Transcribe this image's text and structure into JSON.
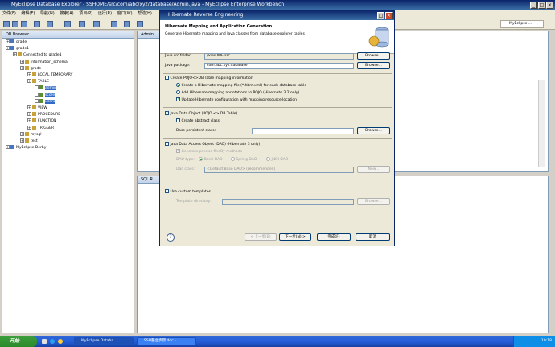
{
  "app": {
    "title": "MyEclipse Database Explorer - SSHOME/src/com/abc/xyz/database/Admin.java - MyEclipse Enterprise Workbench",
    "menu": [
      "文件(F)",
      "编辑(E)",
      "导航(N)",
      "搜索(A)",
      "项目(P)",
      "运行(R)",
      "窗口(W)",
      "帮助(H)"
    ],
    "perspective_label": "MyEclipse ...",
    "editor_tab": "Admin",
    "sql_tab": "SQL R"
  },
  "explorer": {
    "title": "DB Browser",
    "tree": [
      {
        "label": "grade",
        "level": 0,
        "icon": "db"
      },
      {
        "label": "grade1",
        "level": 0,
        "icon": "db"
      },
      {
        "label": "Connected to grade1",
        "level": 1,
        "icon": "folder"
      },
      {
        "label": "information_schema",
        "level": 2,
        "icon": "folder"
      },
      {
        "label": "grade",
        "level": 2,
        "icon": "folder"
      },
      {
        "label": "LOCAL TEMPORARY",
        "level": 3,
        "icon": "folder"
      },
      {
        "label": "TABLE",
        "level": 3,
        "icon": "folder"
      },
      {
        "label": "admin",
        "level": 4,
        "icon": "table",
        "selected": true
      },
      {
        "label": "score",
        "level": 4,
        "icon": "table",
        "selected": true
      },
      {
        "label": "users",
        "level": 4,
        "icon": "table",
        "selected": true
      },
      {
        "label": "VIEW",
        "level": 3,
        "icon": "folder"
      },
      {
        "label": "PROCEDURE",
        "level": 3,
        "icon": "folder"
      },
      {
        "label": "FUNCTION",
        "level": 3,
        "icon": "folder"
      },
      {
        "label": "TRIGGER",
        "level": 3,
        "icon": "folder"
      },
      {
        "label": "mysql",
        "level": 2,
        "icon": "folder"
      },
      {
        "label": "test",
        "level": 2,
        "icon": "folder"
      },
      {
        "label": "MyEclipse Derby",
        "level": 0,
        "icon": "db"
      }
    ]
  },
  "dialog": {
    "title": "Hibernate Reverse Engineering",
    "header_title": "Hibernate Mapping and Application Generation",
    "header_desc": "Generate Hibernate mapping and Java classes from database explorer tables",
    "java_src_label": "Java src folder:",
    "java_src_value": "/SSHOME/src",
    "java_package_label": "Java package:",
    "java_package_value": "com.abc.xyz.database",
    "browse_label": "Browse...",
    "create_pojo_label": "Create POJO<>DB Table mapping information",
    "opt_xml_label": "Create a Hibernate mapping file (*.hbm.xml) for each database table",
    "opt_annot_label": "Add Hibernate mapping annotations to POJO (Hibernate 3.2 only)",
    "update_config_label": "Update Hibernate configuration with mapping resource location",
    "java_data_object_label": "Java Data Object (POJO <> DB Table)",
    "abstract_class_label": "Create abstract class",
    "base_class_label": "Base persistent class:",
    "dao_label": "Java Data Access Object (DAO) (Hibernate 3 only)",
    "finder_label": "Generate precise findBy methods",
    "dao_type_label": "DAO type:",
    "dao_basic": "Basic DAO",
    "dao_spring": "Spring DAO",
    "dao_jndi": "JNDI DAO",
    "dao_class_label": "Dao class:",
    "dao_class_value": "<Default Base DAO> (recommended)",
    "new_label": "New...",
    "custom_template_label": "Use custom templates",
    "template_dir_label": "Template directory:",
    "back_label": "< 上一步(B)",
    "next_label": "下一步(N) >",
    "finish_label": "完成(F)",
    "cancel_label": "取消"
  },
  "taskbar": {
    "start": "开始",
    "tasks": [
      "MyEclipse Databa...",
      "SSH整合步骤.doc -..."
    ],
    "clock": "19:18"
  }
}
